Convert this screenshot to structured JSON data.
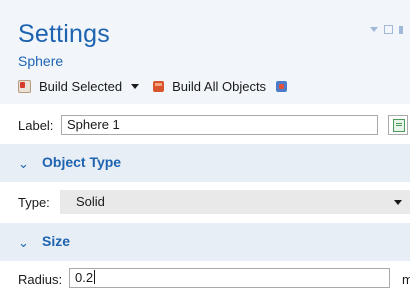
{
  "header": {
    "title": "Settings",
    "subtitle": "Sphere"
  },
  "toolbar": {
    "build_selected": "Build Selected",
    "build_all": "Build All Objects"
  },
  "label_row": {
    "label": "Label:",
    "value": "Sphere 1"
  },
  "object_type": {
    "section_title": "Object Type",
    "type_label": "Type:",
    "type_value": "Solid"
  },
  "size": {
    "section_title": "Size",
    "radius_label": "Radius:",
    "radius_value": "0.2",
    "unit": "m"
  },
  "colors": {
    "accent": "#1e63b0",
    "header_bg": "#f2f6fb",
    "section_bg": "#e8eef6"
  }
}
